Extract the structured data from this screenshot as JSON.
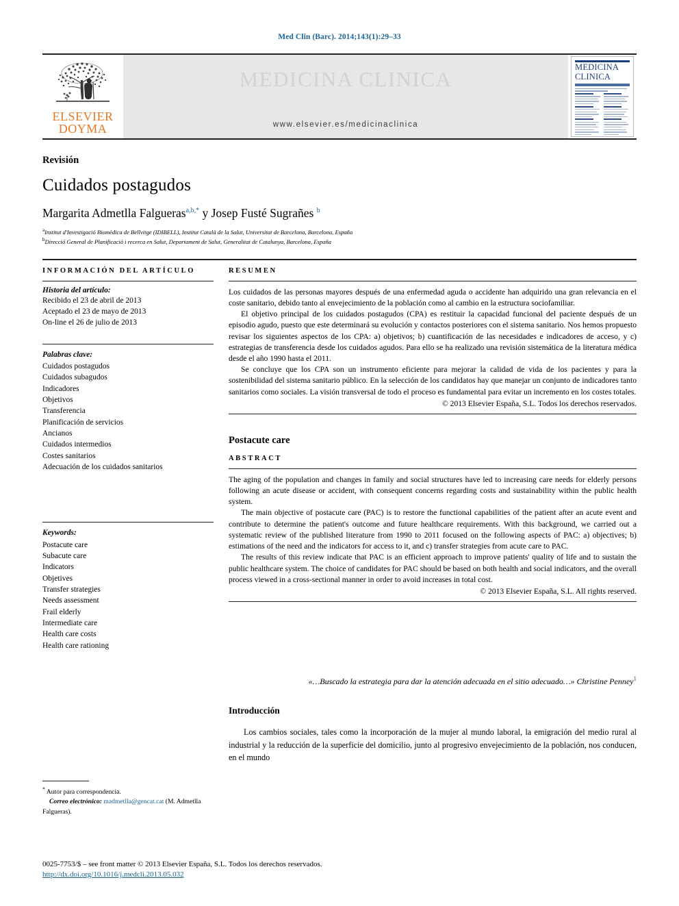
{
  "running_head": "Med Clin (Barc). 2014;143(1):29–33",
  "masthead": {
    "publisher_line1": "ELSEVIER",
    "publisher_line2": "DOYMA",
    "journal_wordmark": "MEDICINA CLINICA",
    "journal_url": "www.elsevier.es/medicinaclinica",
    "cover": {
      "title_line1": "MEDICINA",
      "title_line2": "CLINICA"
    }
  },
  "article": {
    "section_kind": "Revisión",
    "title": "Cuidados postagudos",
    "authors": "Margarita Admetlla Falgueras",
    "author_marks_1": "a,b,*",
    "authors_join": " y Josep Fusté Sugrañes ",
    "author_marks_2": "b",
    "affiliations": [
      {
        "mark": "a",
        "text": "Institut d'Investigació Biomèdica de Bellvitge (IDIBELL), Institut Català de la Salut, Universitat de Barcelona, Barcelona, España"
      },
      {
        "mark": "b",
        "text": "Direcció General de Planificació i recerca en Salut, Departament de Salut, Generalitat de Catalunya, Barcelona, España"
      }
    ]
  },
  "info_column": {
    "heading": "INFORMACIÓN DEL ARTÍCULO",
    "history_label": "Historia del artículo:",
    "history": [
      "Recibido el 23 de abril de 2013",
      "Aceptado el 23 de mayo de 2013",
      "On-line el 26 de julio de 2013"
    ],
    "keywords_label": "Palabras clave:",
    "keywords": [
      "Cuidados postagudos",
      "Cuidados subagudos",
      "Indicadores",
      "Objetivos",
      "Transferencia",
      "Planificación de servicios",
      "Ancianos",
      "Cuidados intermedios",
      "Costes sanitarios",
      "Adecuación de los cuidados sanitarios"
    ],
    "keywords_en_label": "Keywords:",
    "keywords_en": [
      "Postacute care",
      "Subacute care",
      "Indicators",
      "Objetives",
      "Transfer strategies",
      "Needs assessment",
      "Frail elderly",
      "Intermediate care",
      "Health care costs",
      "Health care rationing"
    ]
  },
  "abstract_es": {
    "heading": "RESUMEN",
    "paragraphs": [
      "Los cuidados de las personas mayores después de una enfermedad aguda o accidente han adquirido una gran relevancia en el coste sanitario, debido tanto al envejecimiento de la población como al cambio en la estructura sociofamiliar.",
      "El objetivo principal de los cuidados postagudos (CPA) es restituir la capacidad funcional del paciente después de un episodio agudo, puesto que este determinará su evolución y contactos posteriores con el sistema sanitario. Nos hemos propuesto revisar los siguientes aspectos de los CPA: a) objetivos; b) cuantificación de las necesidades e indicadores de acceso, y c) estrategias de transferencia desde los cuidados agudos. Para ello se ha realizado una revisión sistemática de la literatura médica desde el año 1990 hasta el 2011.",
      "Se concluye que los CPA son un instrumento eficiente para mejorar la calidad de vida de los pacientes y para la sostenibilidad del sistema sanitario público. En la selección de los candidatos hay que manejar un conjunto de indicadores tanto sanitarios como sociales. La visión transversal de todo el proceso es fundamental para evitar un incremento en los costes totales."
    ],
    "copyright": "© 2013 Elsevier España, S.L. Todos los derechos reservados."
  },
  "abstract_en": {
    "title": "Postacute care",
    "heading": "ABSTRACT",
    "paragraphs": [
      "The aging of the population and changes in family and social structures have led to increasing care needs for elderly persons following an acute disease or accident, with consequent concerns regarding costs and sustainability within the public health system.",
      "The main objective of postacute care (PAC) is to restore the functional capabilities of the patient after an acute event and contribute to determine the patient's outcome and future healthcare requirements. With this background, we carried out a systematic review of the published literature from 1990 to 2011 focused on the following aspects of PAC: a) objectives; b) estimations of the need and the indicators for access to it, and c) transfer strategies from acute care to PAC.",
      "The results of this review indicate that PAC is an efficient approach to improve patients' quality of life and to sustain the public healthcare system. The choice of candidates for PAC should be based on both health and social indicators, and the overall process viewed in a cross-sectional manner in order to avoid increases in total cost."
    ],
    "copyright": "© 2013 Elsevier España, S.L. All rights reserved."
  },
  "body": {
    "epigraph_text": "«…Buscado la estrategia para dar la atención adecuada en el sitio adecuado…» Christine Penney",
    "epigraph_ref": "1",
    "intro_heading": "Introducción",
    "intro_paragraph": "Los cambios sociales, tales como la incorporación de la mujer al mundo laboral, la emigración del medio rural al industrial y la reducción de la superficie del domicilio, junto al progresivo envejecimiento de la población, nos conducen, en el mundo"
  },
  "correspondence": {
    "star": "*",
    "label": "Autor para correspondencia.",
    "email_label": "Correo electrónico:",
    "email": "madmetlla@gencat.cat",
    "email_owner": "(M. Admetlla Falgueras)."
  },
  "footer": {
    "issn_line": "0025-7753/$ – see front matter © 2013 Elsevier España, S.L. Todos los derechos reservados.",
    "doi": "http://dx.doi.org/10.1016/j.medcli.2013.05.032"
  },
  "colors": {
    "link_blue": "#1a6496",
    "elsevier_orange": "#e87722",
    "cover_navy": "#1b3f78",
    "masthead_gray": "#e7e7e7"
  }
}
